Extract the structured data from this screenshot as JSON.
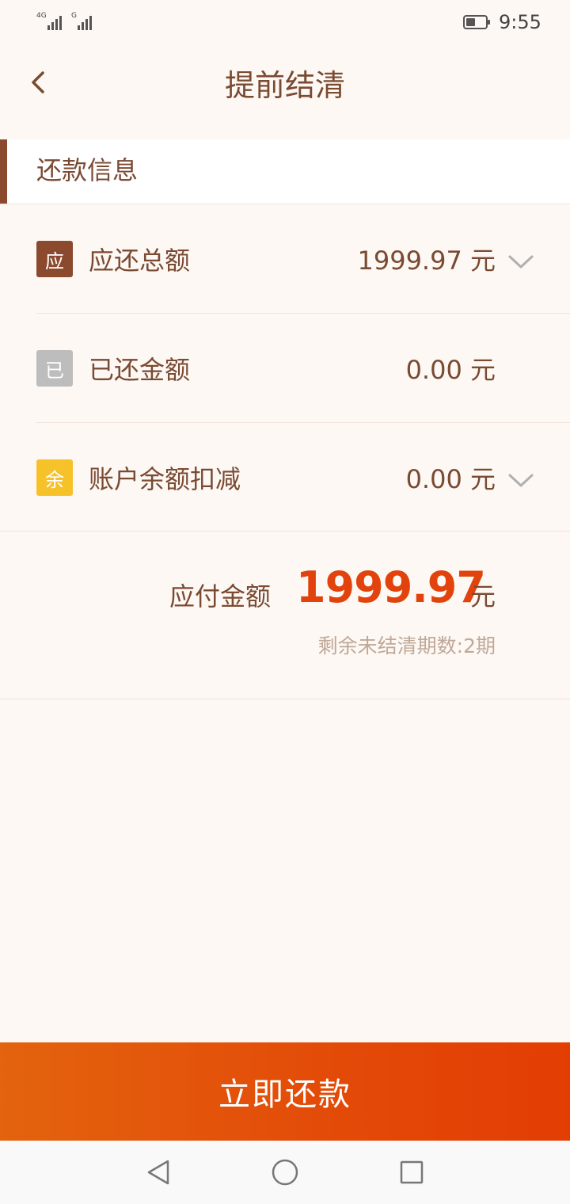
{
  "status_bar": {
    "signal1_tag": "4G",
    "signal2_tag": "G",
    "time": "9:55",
    "icons": [
      "signal-icon",
      "signal-icon",
      "battery-icon"
    ]
  },
  "header": {
    "title": "提前结清",
    "back_icon": "chevron-left-icon"
  },
  "section": {
    "title": "还款信息"
  },
  "rows": [
    {
      "badge": "应",
      "badge_color": "#8b4a2e",
      "label": "应还总额",
      "value": "1999.97 元",
      "expandable": true
    },
    {
      "badge": "已",
      "badge_color": "#bdbdbd",
      "label": "已还金额",
      "value": "0.00 元",
      "expandable": false
    },
    {
      "badge": "余",
      "badge_color": "#f7c12a",
      "label": "账户余额扣减",
      "value": "0.00 元",
      "expandable": true
    }
  ],
  "summary": {
    "label": "应付金额",
    "amount": "1999.97",
    "unit": "元",
    "remaining": "剩余未结清期数:2期"
  },
  "pay_button": {
    "label": "立即还款"
  },
  "colors": {
    "background": "#fdf8f4",
    "accent_brown": "#8b4a2e",
    "text_brown": "#7a4a32",
    "amount_orange": "#e2430c",
    "button_gradient_start": "#e3630e",
    "button_gradient_end": "#e33d04"
  },
  "system_nav": {
    "icons": [
      "back-triangle-icon",
      "home-circle-icon",
      "recents-square-icon"
    ]
  }
}
